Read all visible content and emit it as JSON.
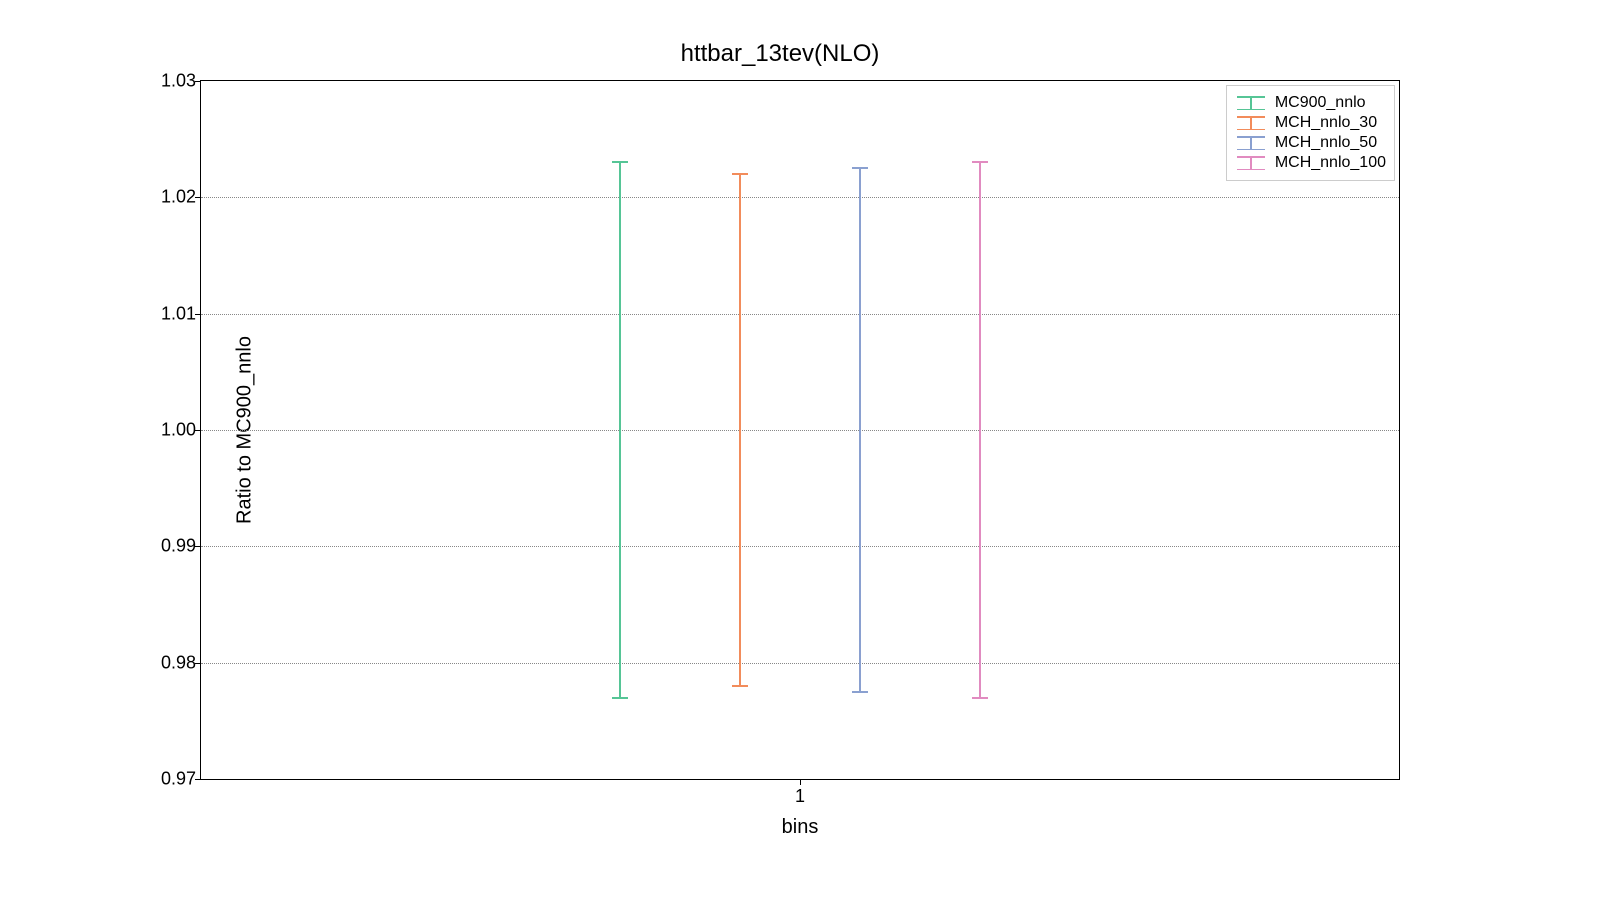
{
  "chart_data": {
    "type": "errorbar",
    "title": "httbar_13tev(NLO)",
    "xlabel": "bins",
    "ylabel": "Ratio to MC900_nnlo",
    "ylim": [
      0.97,
      1.03
    ],
    "yticks": [
      0.97,
      0.98,
      0.99,
      1.0,
      1.01,
      1.02,
      1.03
    ],
    "ytick_labels": [
      "0.97",
      "0.98",
      "0.99",
      "1.00",
      "1.01",
      "1.02",
      "1.03"
    ],
    "grid_y_at": [
      0.98,
      0.99,
      1.0,
      1.01,
      1.02
    ],
    "x_categories": [
      "1"
    ],
    "series": [
      {
        "name": "MC900_nnlo",
        "color": "#56c596",
        "x_offset": -0.3,
        "y": 1.0,
        "ylo": 0.977,
        "yhi": 1.023
      },
      {
        "name": "MCH_nnlo_30",
        "color": "#f28c5b",
        "x_offset": -0.1,
        "y": 1.0,
        "ylo": 0.978,
        "yhi": 1.022
      },
      {
        "name": "MCH_nnlo_50",
        "color": "#8aa0d0",
        "x_offset": 0.1,
        "y": 1.0,
        "ylo": 0.9775,
        "yhi": 1.0225
      },
      {
        "name": "MCH_nnlo_100",
        "color": "#e18bc0",
        "x_offset": 0.3,
        "y": 1.0,
        "ylo": 0.977,
        "yhi": 1.023
      }
    ]
  }
}
